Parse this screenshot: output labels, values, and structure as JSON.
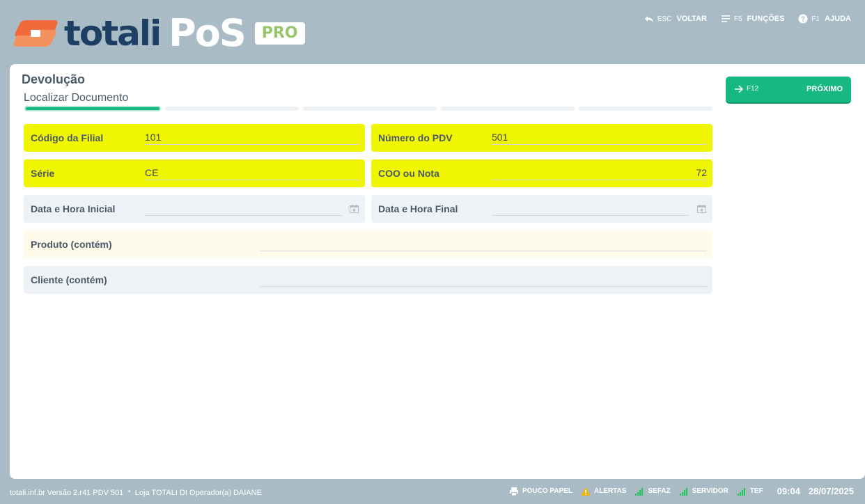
{
  "brand": {
    "name": "totali",
    "product": "PoS",
    "edition": "PRO"
  },
  "header_actions": [
    {
      "key": "ESC",
      "label": "VOLTAR",
      "icon": "undo-arrow-icon"
    },
    {
      "key": "F5",
      "label": "FUNÇÕES",
      "icon": "menu-lines-icon"
    },
    {
      "key": "F1",
      "label": "AJUDA",
      "icon": "help-circle-icon"
    }
  ],
  "page": {
    "title": "Devolução",
    "step_title": "Localizar Documento"
  },
  "steps": {
    "total": 5,
    "current": 1
  },
  "form": {
    "codigo_filial": {
      "label": "Código da Filial",
      "value": "101"
    },
    "numero_pdv": {
      "label": "Número do PDV",
      "value": "501"
    },
    "serie": {
      "label": "Série",
      "value": "CE"
    },
    "coo_nota": {
      "label": "COO ou Nota",
      "value": "72"
    },
    "data_inicial": {
      "label": "Data e Hora Inicial",
      "value": ""
    },
    "data_final": {
      "label": "Data e Hora Final",
      "value": ""
    },
    "produto": {
      "label": "Produto (contém)",
      "value": ""
    },
    "cliente": {
      "label": "Cliente (contém)",
      "value": ""
    }
  },
  "next_button": {
    "key": "F12",
    "label": "PRÓXIMO"
  },
  "status_bar": {
    "info": "totali.inf.br Versão 2.r41 PDV 501  *  Loja TOTALI DI Operador(a) DAIANE",
    "items": [
      {
        "label": "POUCO PAPEL",
        "icon": "printer-icon"
      },
      {
        "label": "ALERTAS",
        "icon": "warning-icon"
      },
      {
        "label": "SEFAZ",
        "icon": "signal-icon"
      },
      {
        "label": "SERVIDOR",
        "icon": "signal-icon"
      },
      {
        "label": "TEF",
        "icon": "signal-icon"
      }
    ],
    "time": "09:04",
    "date": "28/07/2025"
  },
  "colors": {
    "accent": "#17b884",
    "highlight": "#f0f500",
    "header_bg": "#a9bcc6",
    "logo_orange": "#f06a3c",
    "logo_navy": "#1d3f63",
    "pro_green": "#98c66a"
  }
}
